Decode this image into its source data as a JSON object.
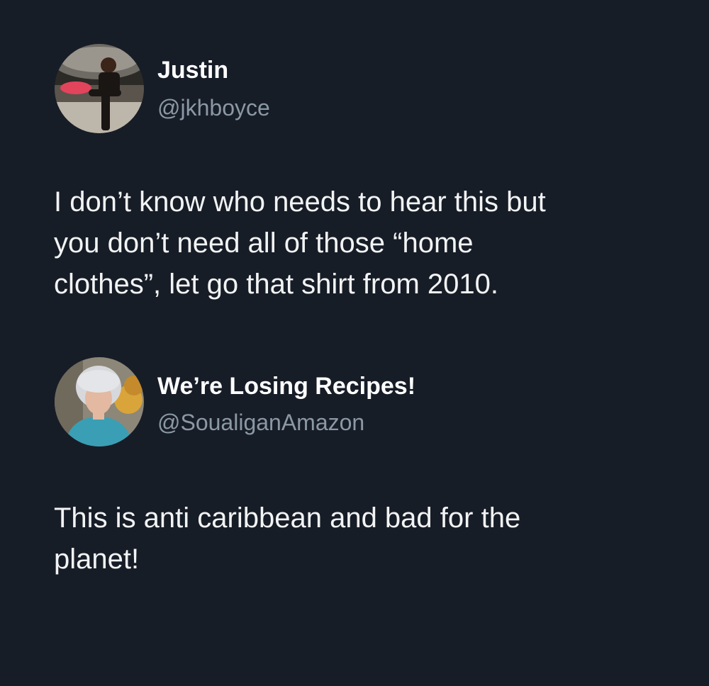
{
  "tweets": [
    {
      "display_name": "Justin",
      "handle": "@jkhboyce",
      "avatar_icon": "user-avatar-photo",
      "text_lines": [
        "I don’t know who needs to hear this but",
        "you don’t need all of those “home",
        "clothes”, let go that shirt from 2010."
      ]
    },
    {
      "display_name": "We’re Losing Recipes!",
      "handle": "@SoualiganAmazon",
      "avatar_icon": "user-avatar-photo",
      "text_lines": [
        "This is anti caribbean and bad for the",
        "planet!"
      ]
    }
  ],
  "colors": {
    "background": "#171d27",
    "name": "#ffffff",
    "handle": "#8b98a5",
    "text": "#f2f3f4"
  }
}
